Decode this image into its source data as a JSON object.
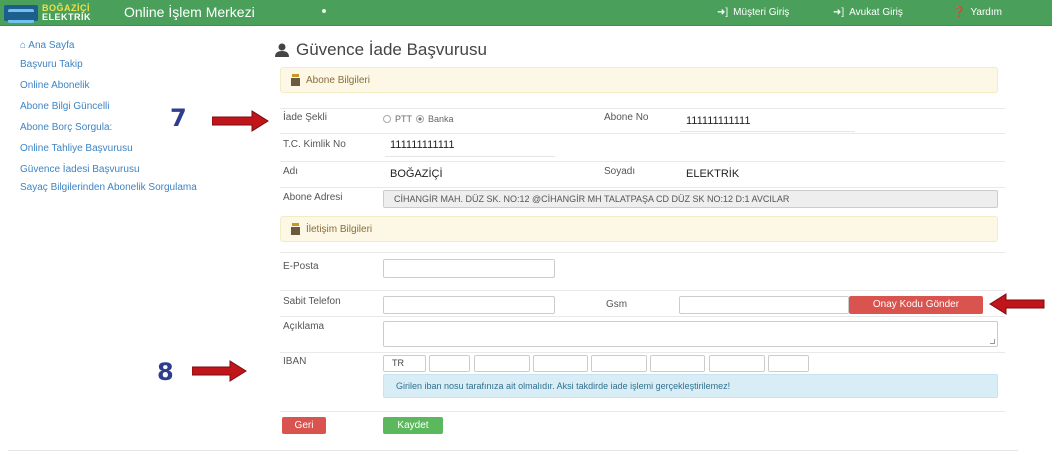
{
  "navbar": {
    "logo_line1": "BOĞAZİÇİ",
    "logo_line2": "ELEKTRİK",
    "title": "Online İşlem Merkezi",
    "links": [
      {
        "label": "Müşteri Giriş",
        "icon": "sign-in-icon"
      },
      {
        "label": "Avukat Giriş",
        "icon": "sign-in-icon"
      },
      {
        "label": "Yardım",
        "icon": "question-circle-icon"
      }
    ]
  },
  "sidebar": {
    "items": [
      {
        "label": "Ana Sayfa",
        "icon": "home-icon"
      },
      {
        "label": "Başvuru Takip"
      },
      {
        "label": "Online Abonelik"
      },
      {
        "label": "Abone Bilgi Güncelli"
      },
      {
        "label": "Abone Borç Sorgula:"
      },
      {
        "label": "Online Tahliye Başvurusu"
      },
      {
        "label": "Güvence İadesi Başvurusu"
      },
      {
        "label": "Sayaç Bilgilerinden Abonelik Sorgulama"
      }
    ]
  },
  "annotations": {
    "marker_7": "7",
    "marker_8": "8",
    "arrow_color": "#c0151b"
  },
  "page": {
    "title": "Güvence İade Başvurusu",
    "title_icon": "user-icon"
  },
  "section_abone": {
    "title": "Abone Bilgileri",
    "icon": "user-tie-icon"
  },
  "form": {
    "iade_sekli_label": "İade Şekli",
    "iade_options": [
      "PTT",
      "Banka"
    ],
    "iade_selected": "Banka",
    "abone_no_label": "Abone No",
    "abone_no_value": "111111111111",
    "tc_label": "T.C. Kimlik No",
    "tc_value": "111111111111",
    "adi_label": "Adı",
    "adi_value": "BOĞAZİÇİ",
    "soyadi_label": "Soyadı",
    "soyadi_value": "ELEKTRİK",
    "adres_label": "Abone Adresi",
    "adres_value": "CİHANGİR MAH. DÜZ SK. NO:12 @CİHANGİR MH TALATPAŞA CD DÜZ SK NO:12 D:1 AVCILAR"
  },
  "section_iletisim": {
    "title": "İletişim Bilgileri",
    "icon": "user-tie-icon"
  },
  "contact": {
    "eposta_label": "E-Posta",
    "eposta_value": "",
    "sabit_label": "Sabit Telefon",
    "sabit_value": "",
    "gsm_label": "Gsm",
    "gsm_value": "",
    "onay_button": "Onay Kodu Gönder",
    "aciklama_label": "Açıklama",
    "aciklama_value": "",
    "iban_label": "IBAN",
    "iban_prefix": "TR",
    "iban_info": "Girilen iban nosu tarafınıza ait olmalıdır. Aksi takdirde iade işlemi gerçekleştirilemez!"
  },
  "actions": {
    "back": "Geri",
    "save": "Kaydet"
  },
  "colors": {
    "navbar": "#4aa05a",
    "link": "#3d84c4",
    "danger": "#d9534f",
    "success": "#5cb85c",
    "warning_bg": "#fcf8e5",
    "info_bg": "#d9edf7"
  }
}
